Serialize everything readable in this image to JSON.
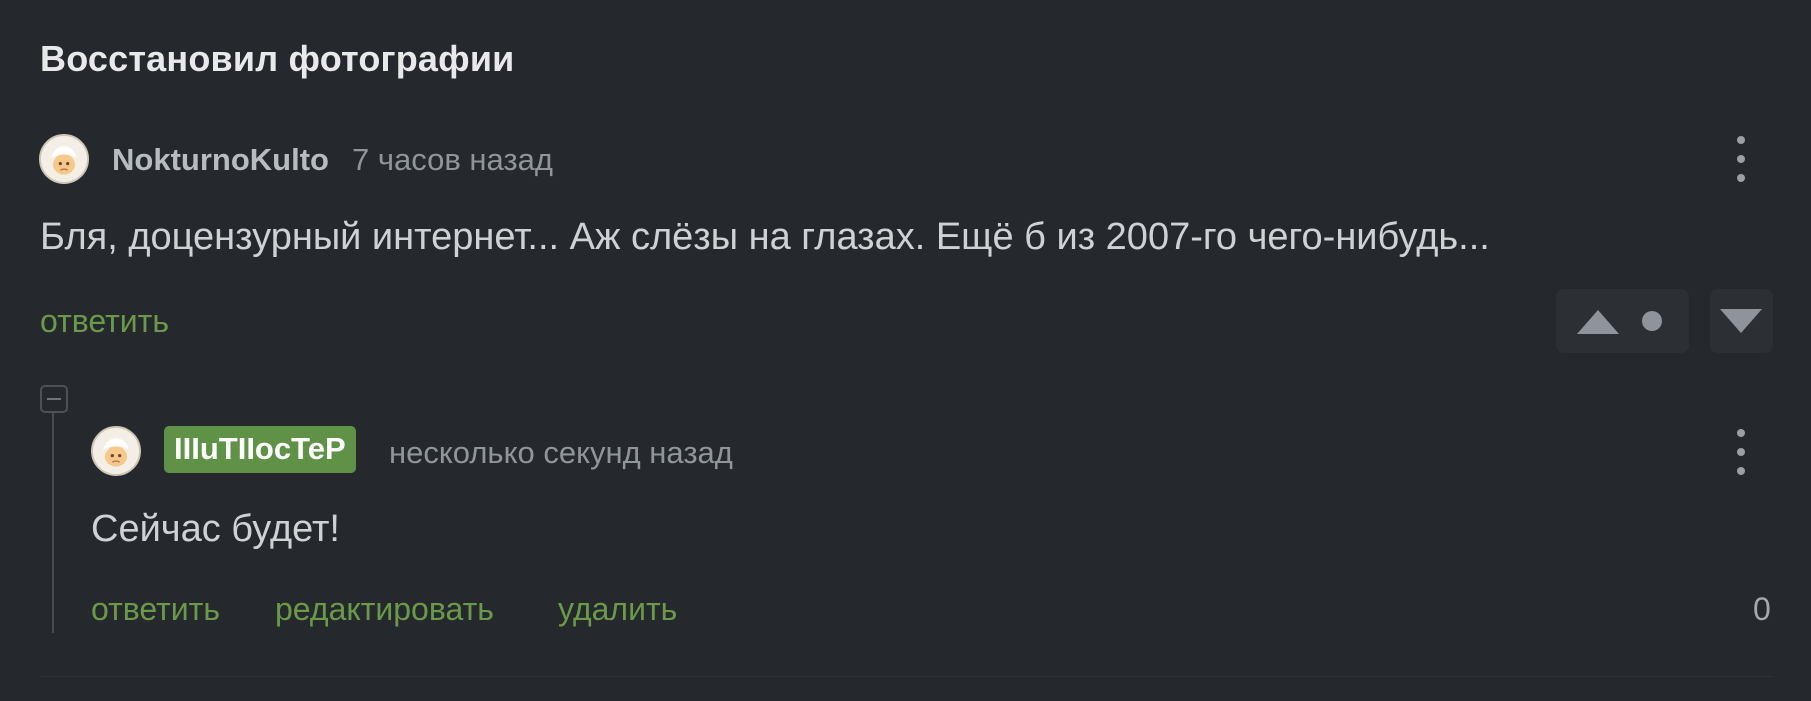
{
  "post": {
    "title": "Восстановил фотографии"
  },
  "comment": {
    "username": "NokturnoKulto",
    "time": "7 часов назад",
    "text": "Бля, доцензурный интернет... Аж слёзы на глазах. Ещё б из 2007-го чего-нибудь...",
    "reply_label": "ответить",
    "avatar_icon": "avatar-icon",
    "menu_icon": "more-vertical-icon",
    "upvote_icon": "triangle-up-icon",
    "downvote_icon": "triangle-down-icon",
    "score_icon": "dot-icon"
  },
  "reply": {
    "username": "IIIuTIIocTeP",
    "time": "несколько секунд назад",
    "text": "Сейчас будет!",
    "reply_label": "ответить",
    "edit_label": "редактировать",
    "delete_label": "удалить",
    "score": "0",
    "collapse_icon": "minus-icon"
  },
  "colors": {
    "background": "#25292d",
    "accent_green": "#6a9a48",
    "badge_green": "#5f9147"
  }
}
